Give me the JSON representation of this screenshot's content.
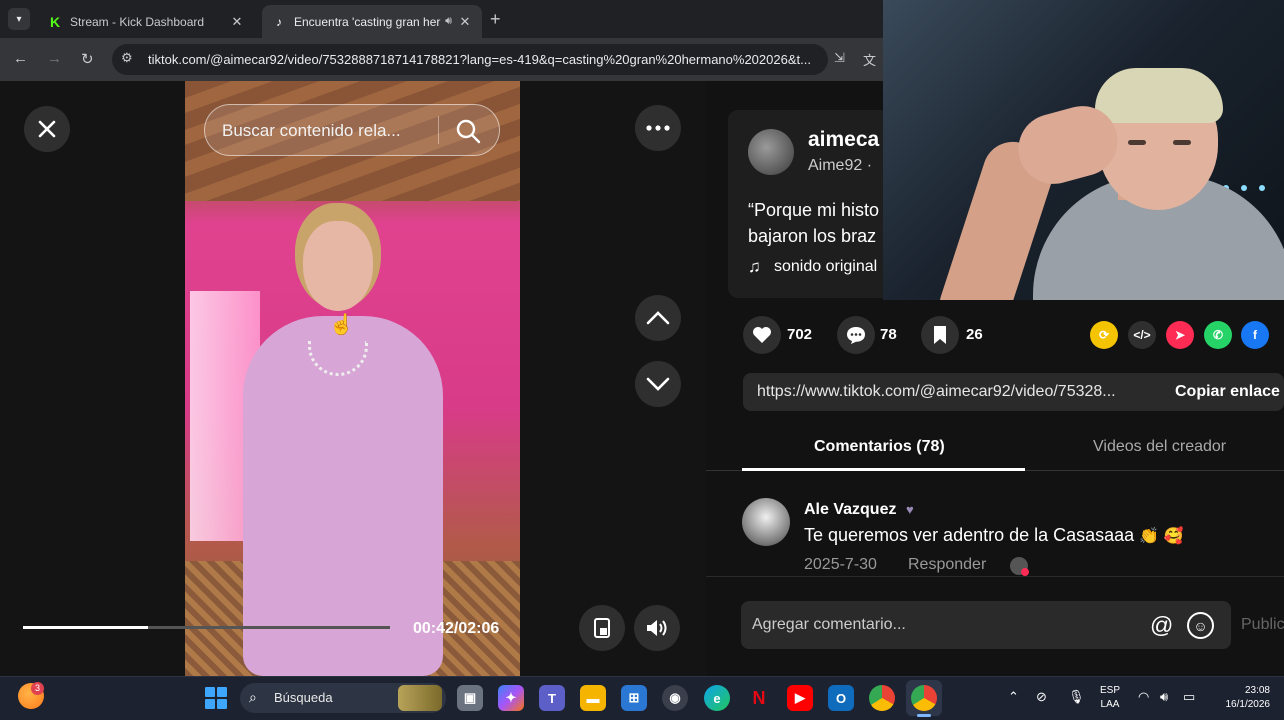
{
  "browser": {
    "tabs": [
      {
        "title": "Stream - Kick Dashboard",
        "icon": "kick-favicon"
      },
      {
        "title": "Encuentra 'casting gran her",
        "icon": "tiktok-favicon",
        "audio": true
      }
    ],
    "url": "tiktok.com/@aimecar92/video/7532888718714178821?lang=es-419&q=casting%20gran%20hermano%202026&t..."
  },
  "video": {
    "search_placeholder": "Buscar contenido rela...",
    "current_time": "00:42",
    "duration": "02:06",
    "time_display": "00:42/02:06",
    "progress": 0.34
  },
  "author": {
    "username": "aimeca",
    "nickname": "Aime92 · ",
    "description": "“Porque mi histo bajaron los braz",
    "sound": "sonido original"
  },
  "actions": {
    "likes": "702",
    "comments": "78",
    "saves": "26"
  },
  "share": {
    "link": "https://www.tiktok.com/@aimecar92/video/75328...",
    "copy_label": "Copiar enlace"
  },
  "tabs": {
    "comments": "Comentarios (78)",
    "creator_videos": "Videos del creador"
  },
  "comment": {
    "user": "Ale Vazquez",
    "text": "Te queremos ver adentro de la Casasaaa",
    "emoji": "👏 🥰",
    "date": "2025-7-30",
    "reply": "Responder"
  },
  "composer": {
    "placeholder": "Agregar comentario...",
    "post": "Publicar"
  },
  "taskbar": {
    "search": "Búsqueda",
    "lang_top": "ESP",
    "lang_bottom": "LAA",
    "time": "23:08",
    "date": "16/1/2026",
    "widget_badge": "3"
  },
  "colors": {
    "accent": "#fe2c55",
    "panel": "#121212",
    "kick_green": "#53fc18"
  }
}
